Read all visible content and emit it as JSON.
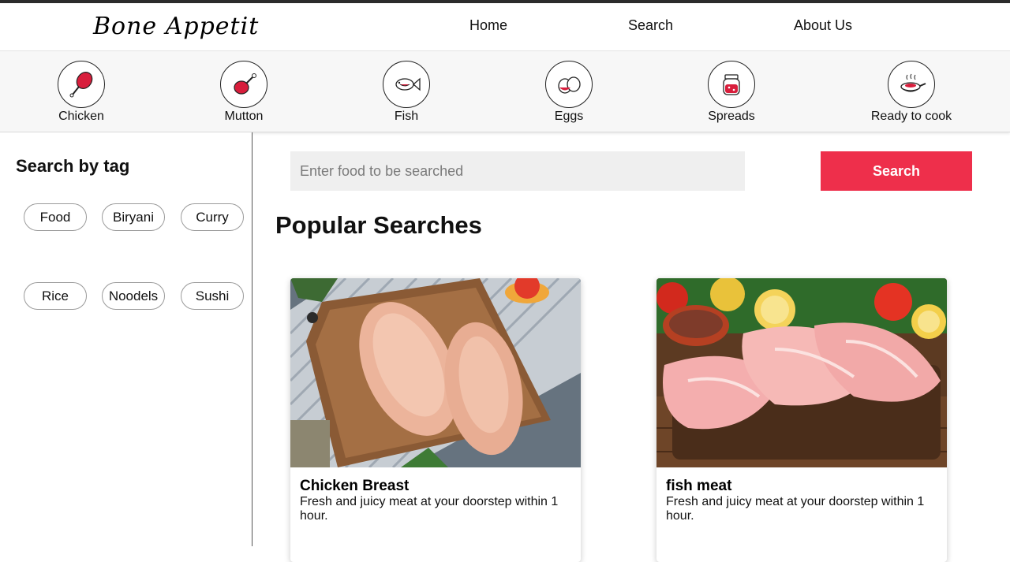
{
  "brand": {
    "logo_text": "Bone Appetit"
  },
  "nav": {
    "home": "Home",
    "search": "Search",
    "about": "About Us"
  },
  "categories": [
    {
      "label": "Chicken",
      "icon": "chicken-leg-icon"
    },
    {
      "label": "Mutton",
      "icon": "mutton-icon"
    },
    {
      "label": "Fish",
      "icon": "fish-icon"
    },
    {
      "label": "Eggs",
      "icon": "eggs-icon"
    },
    {
      "label": "Spreads",
      "icon": "jar-icon"
    },
    {
      "label": "Ready to cook",
      "icon": "pan-icon"
    }
  ],
  "sidebar": {
    "title": "Search by tag",
    "tags": [
      "Food",
      "Biryani",
      "Curry",
      "Rice",
      "Noodels",
      "Sushi"
    ]
  },
  "search": {
    "placeholder": "Enter food to be searched",
    "value": "",
    "button_label": "Search"
  },
  "popular": {
    "title": "Popular Searches",
    "items": [
      {
        "title": "Chicken Breast",
        "description": "Fresh and juicy meat at your doorstep within 1 hour."
      },
      {
        "title": "fish meat",
        "description": "Fresh and juicy meat at your doorstep within 1 hour."
      }
    ]
  },
  "colors": {
    "accent": "#ee2f4b",
    "icon_red": "#d81e3c"
  }
}
